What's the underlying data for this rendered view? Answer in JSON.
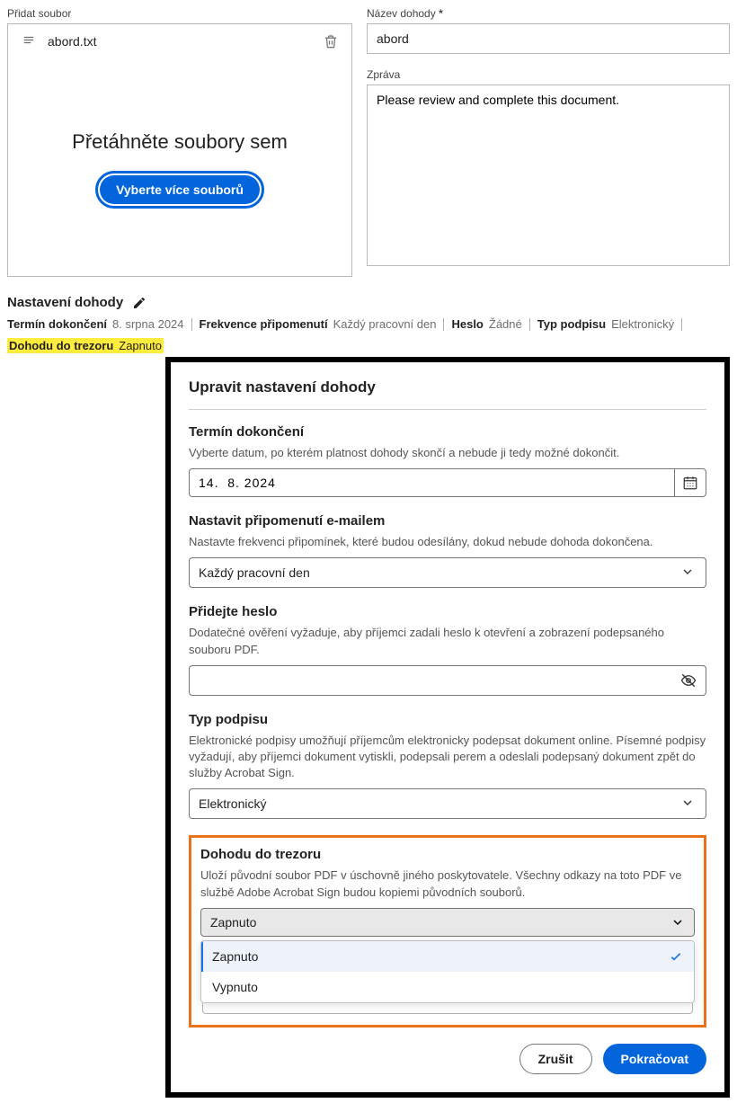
{
  "file_section": {
    "label": "Přidat soubor",
    "file_name": "abord.txt",
    "drop_text": "Přetáhněte soubory sem",
    "pick_button": "Vyberte více souborů"
  },
  "agreement_name": {
    "label": "Název dohody",
    "required_mark": "*",
    "value": "abord"
  },
  "message": {
    "label": "Zpráva",
    "value": "Please review and complete this document."
  },
  "settings": {
    "header": "Nastavení dohody",
    "items": [
      {
        "key": "Termín dokončení",
        "val": "8. srpna 2024"
      },
      {
        "key": "Frekvence připomenutí",
        "val": "Každý pracovní den"
      },
      {
        "key": "Heslo",
        "val": "Žádné"
      },
      {
        "key": "Typ podpisu",
        "val": "Elektronický"
      }
    ],
    "highlight": {
      "key": "Dohodu do trezoru",
      "val": "Zapnuto"
    }
  },
  "modal": {
    "title": "Upravit nastavení dohody",
    "deadline": {
      "title": "Termín dokončení",
      "desc": "Vyberte datum, po kterém platnost dohody skončí a nebude ji tedy možné dokončit.",
      "value": "14.  8. 2024"
    },
    "reminder": {
      "title": "Nastavit připomenutí e-mailem",
      "desc": "Nastavte frekvenci připomínek, které budou odesílány, dokud nebude dohoda dokončena.",
      "value": "Každý pracovní den"
    },
    "password": {
      "title": "Přidejte heslo",
      "desc": "Dodatečné ověření vyžaduje, aby příjemci zadali heslo k otevření a zobrazení podepsaného souboru PDF.",
      "value": ""
    },
    "sigtype": {
      "title": "Typ podpisu",
      "desc": "Elektronické podpisy umožňují příjemcům elektronicky podepsat dokument online. Písemné podpisy vyžadují, aby příjemci dokument vytiskli, podepsali perem a odeslali podepsaný dokument zpět do služby Acrobat Sign.",
      "value": "Elektronický"
    },
    "vault": {
      "title": "Dohodu do trezoru",
      "desc": "Uloží původní soubor PDF v úschovně jiného poskytovatele. Všechny odkazy na toto PDF ve službě Adobe Acrobat Sign budou kopiemi původních souborů.",
      "selected": "Zapnuto",
      "options": [
        "Zapnuto",
        "Vypnuto"
      ]
    },
    "cancel": "Zrušit",
    "continue": "Pokračovat"
  }
}
